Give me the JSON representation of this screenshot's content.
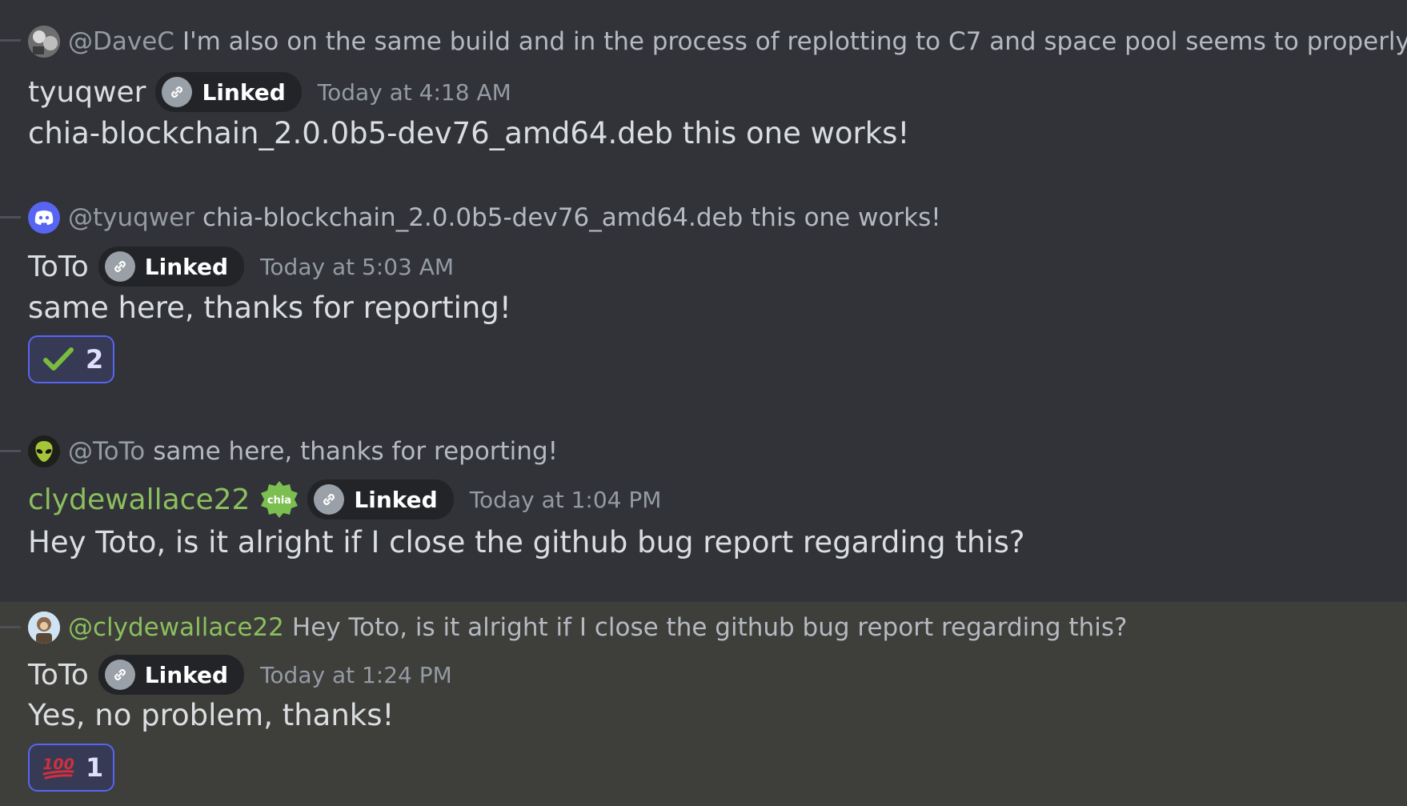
{
  "messages": [
    {
      "reply": {
        "mention": "@DaveC",
        "text": "I'm also on the same build and in the process of replotting to C7 and space pool seems to properly ac",
        "avatar_icon": "avatar-photo-icon"
      },
      "author": "tyuqwer",
      "badge": "Linked",
      "timestamp": "Today at 4:18 AM",
      "content": "chia-blockchain_2.0.0b5-dev76_amd64.deb this one works!"
    },
    {
      "reply": {
        "mention": "@tyuqwer",
        "text": "chia-blockchain_2.0.0b5-dev76_amd64.deb this one works!",
        "avatar_icon": "discord-logo-icon"
      },
      "author": "ToTo",
      "badge": "Linked",
      "timestamp": "Today at 5:03 AM",
      "content": "same here, thanks for reporting!",
      "reaction": {
        "emoji": "check-mark-icon",
        "count": "2"
      }
    },
    {
      "reply": {
        "mention": "@ToTo",
        "text": "same here, thanks for reporting!",
        "avatar_icon": "alien-avatar-icon"
      },
      "author": "clydewallace22",
      "role_badge": "chia",
      "badge": "Linked",
      "timestamp": "Today at 1:04 PM",
      "content": "Hey Toto, is it alright if I close the github bug report regarding this?"
    },
    {
      "reply": {
        "mention": "@clydewallace22",
        "text": "Hey Toto, is it alright if I close the github bug report regarding this?",
        "avatar_icon": "monkey-avatar-icon"
      },
      "author": "ToTo",
      "badge": "Linked",
      "timestamp": "Today at 1:24 PM",
      "content": "Yes, no problem, thanks!",
      "reaction": {
        "emoji": "hundred-points-icon",
        "count": "1"
      }
    }
  ],
  "colors": {
    "background": "#313338",
    "highlight": "#3e3e3b",
    "username_green": "#8bbf5e",
    "reaction_border": "#5865f2"
  }
}
